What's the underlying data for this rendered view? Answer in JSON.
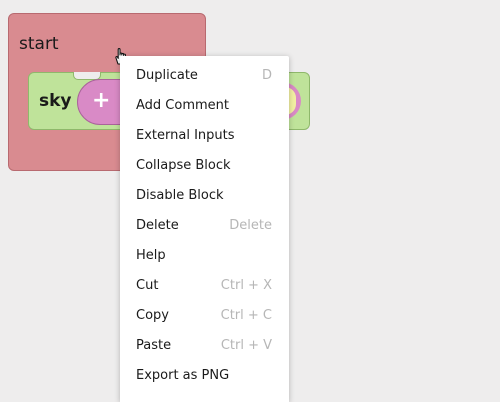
{
  "workspace": {
    "start_block": {
      "label": "start"
    },
    "sky_block": {
      "label": "sky",
      "operator": "+"
    }
  },
  "context_menu": {
    "items": [
      {
        "label": "Duplicate",
        "shortcut": "D"
      },
      {
        "label": "Add Comment",
        "shortcut": ""
      },
      {
        "label": "External Inputs",
        "shortcut": ""
      },
      {
        "label": "Collapse Block",
        "shortcut": ""
      },
      {
        "label": "Disable Block",
        "shortcut": ""
      },
      {
        "label": "Delete",
        "shortcut": "Delete"
      },
      {
        "label": "Help",
        "shortcut": ""
      },
      {
        "label": "Cut",
        "shortcut": "Ctrl + X"
      },
      {
        "label": "Copy",
        "shortcut": "Ctrl + C"
      },
      {
        "label": "Paste",
        "shortcut": "Ctrl + V"
      },
      {
        "label": "Export as PNG",
        "shortcut": ""
      }
    ]
  },
  "colors": {
    "start_block": "#d98b90",
    "sky_block": "#bfe39a",
    "operator_block": "#d98ac6",
    "value_block": "#f2f0a2",
    "workspace_bg": "#eeeded",
    "shortcut_text": "#b6b6b6"
  },
  "icons": {
    "cursor": "hand-pointer-icon"
  }
}
